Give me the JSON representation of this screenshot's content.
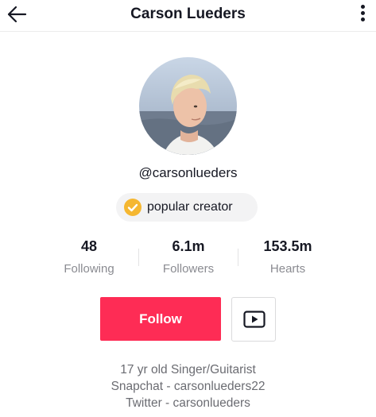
{
  "header": {
    "title": "Carson Lueders",
    "back_icon": "arrow-left-icon",
    "more_icon": "more-vertical-icon"
  },
  "profile": {
    "handle": "@carsonlueders",
    "badge": {
      "label": "popular creator",
      "icon": "check-circle-icon",
      "icon_color": "#f5b731"
    }
  },
  "stats": [
    {
      "value": "48",
      "label": "Following"
    },
    {
      "value": "6.1m",
      "label": "Followers"
    },
    {
      "value": "153.5m",
      "label": "Hearts"
    }
  ],
  "actions": {
    "follow_label": "Follow",
    "follow_color": "#fe2c55",
    "youtube_icon": "youtube-icon"
  },
  "bio": [
    "17 yr old Singer/Guitarist",
    "Snapchat - carsonlueders22",
    "Twitter - carsonlueders"
  ]
}
